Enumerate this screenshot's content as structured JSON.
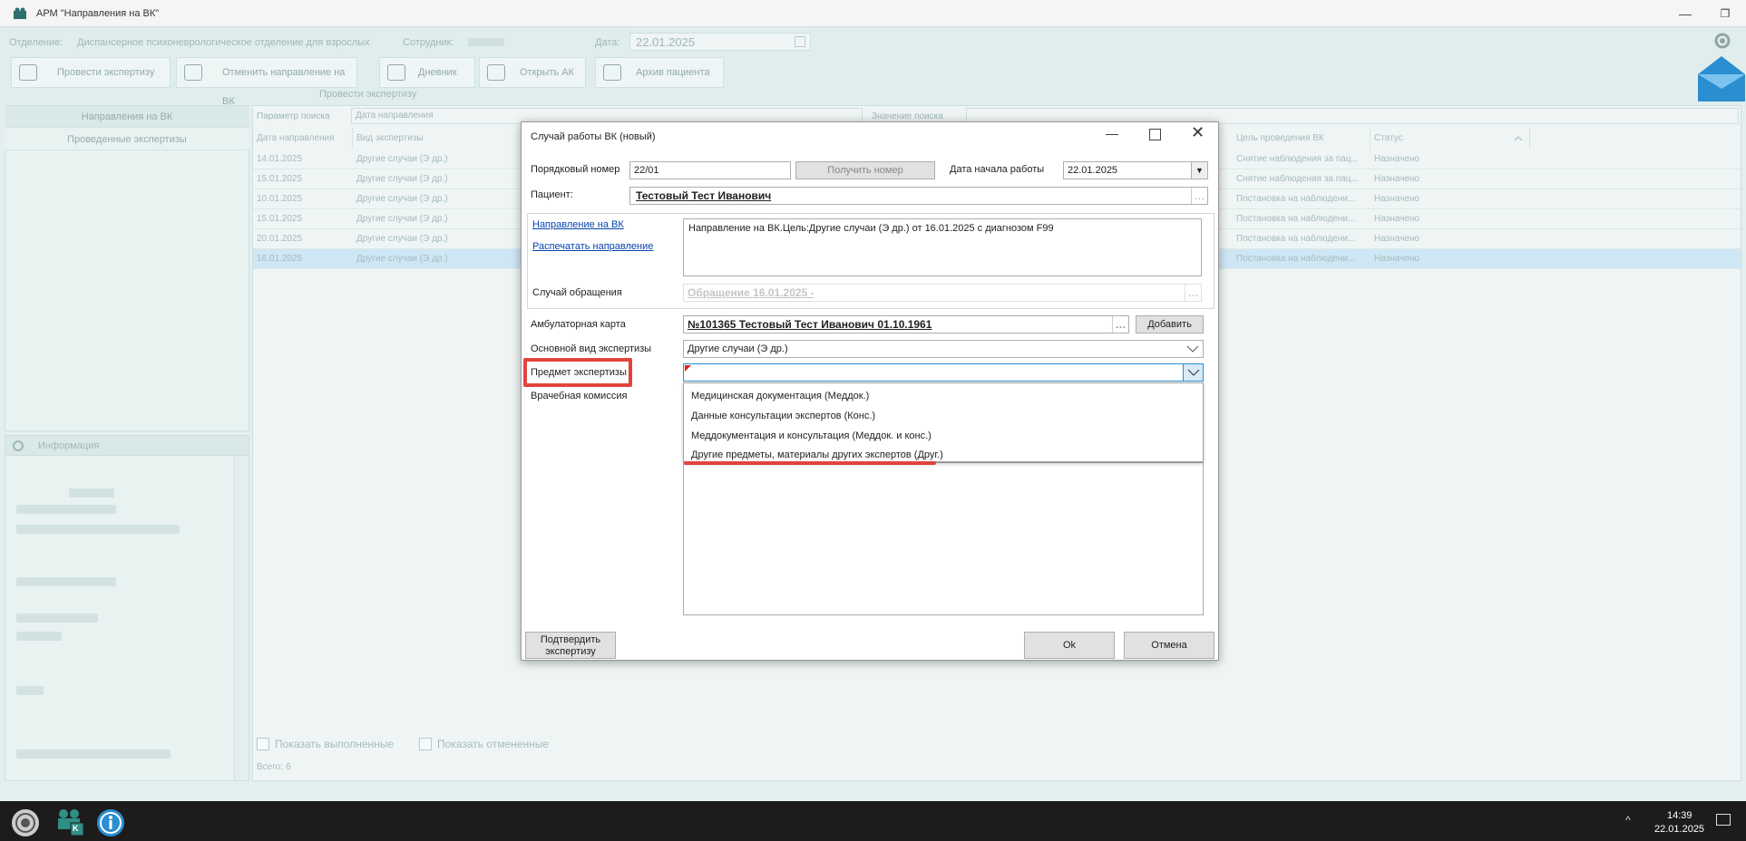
{
  "window": {
    "title": "АРМ \"Направления на ВК\""
  },
  "topbar": {
    "department_label": "Отделение:",
    "department_value": "Диспансерное психоневрологическое отделение для взрослых",
    "employee_label": "Сотрудник:",
    "date_label": "Дата:",
    "date_value": "22.01.2025",
    "buttons": [
      "Провести экспертизу",
      "Отменить направление на ВК",
      "Дневник",
      "Открыть АК",
      "Архив пациента"
    ],
    "group_label": "Провести экспертизу"
  },
  "left_tabs": [
    "Направления на ВК",
    "Проведенные экспертизы"
  ],
  "info_panel": {
    "title": "Информация"
  },
  "search": {
    "param_label": "Параметр поиска",
    "param_value": "Дата направления",
    "value_label": "Значение поиска"
  },
  "grid": {
    "columns": [
      "Дата направления",
      "Вид экспертизы",
      "Цель проведения ВК",
      "Статус"
    ],
    "rows": [
      {
        "date": "14.01.2025",
        "type": "Другие случаи (Э др.)",
        "goal": "Снятие наблюдения за пац...",
        "status": "Назначено"
      },
      {
        "date": "15.01.2025",
        "type": "Другие случаи (Э др.)",
        "goal": "Снятие наблюдения за пац...",
        "status": "Назначено"
      },
      {
        "date": "10.01.2025",
        "type": "Другие случаи (Э др.)",
        "goal": "Постановка на наблюдени...",
        "status": "Назначено"
      },
      {
        "date": "15.01.2025",
        "type": "Другие случаи (Э др.)",
        "goal": "Постановка на наблюдени...",
        "status": "Назначено"
      },
      {
        "date": "20.01.2025",
        "type": "Другие случаи (Э др.)",
        "goal": "Постановка на наблюдени...",
        "status": "Назначено"
      },
      {
        "date": "16.01.2025",
        "type": "Другие случаи (Э др.)",
        "goal": "Постановка на наблюдени...",
        "status": "Назначено"
      }
    ],
    "show_done": "Показать выполненные",
    "show_cancelled": "Показать отмененные",
    "total_label": "Всего:",
    "total_value": "6"
  },
  "dialog": {
    "title": "Случай работы ВК (новый)",
    "seq_label": "Порядковый номер",
    "seq_value": "22/01",
    "get_number": "Получить номер",
    "start_date_label": "Дата начала работы",
    "start_date_value": "22.01.2025",
    "patient_label": "Пациент:",
    "patient_value": "Тестовый Тест Иванович",
    "link_referral": "Направление на ВК",
    "link_print": "Распечатать направление",
    "referral_text": "Направление на ВК.Цель:Другие случаи (Э др.) от 16.01.2025 с диагнозом F99",
    "case_label": "Случай обращения",
    "case_value": "Обращение 16.01.2025 -",
    "card_label": "Амбулаторная карта",
    "card_value": "№101365 Тестовый Тест Иванович 01.10.1961",
    "add_button": "Добавить",
    "main_type_label": "Основной вид экспертизы",
    "main_type_value": "Другие случаи (Э др.)",
    "subject_label": "Предмет экспертизы",
    "commission_label": "Врачебная комиссия",
    "dropdown_options": [
      "Медицинская документация (Меддок.)",
      "Данные консультации экспертов (Конс.)",
      "Меддокументация и консультация (Меддок. и конс.)",
      "Другие предметы, материалы других экспертов (Друг.)"
    ],
    "confirm_button": "Подтвердить экспертизу",
    "ok_button": "Ok",
    "cancel_button": "Отмена"
  },
  "taskbar": {
    "time": "14:39",
    "date": "22.01.2025",
    "badge": "K"
  },
  "colors": {
    "highlight": "#e0443d",
    "accent": "#2a8ed1",
    "selection": "#cfe6f5"
  }
}
